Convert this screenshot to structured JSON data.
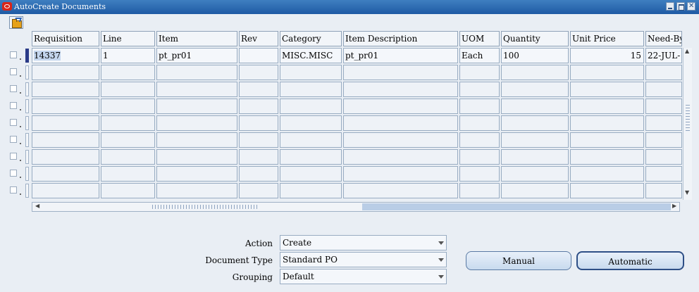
{
  "window": {
    "title": "AutoCreate Documents"
  },
  "table": {
    "columns": [
      "Requisition",
      "Line",
      "Item",
      "Rev",
      "Category",
      "Item Description",
      "UOM",
      "Quantity",
      "Unit Price",
      "Need-By"
    ],
    "rows": [
      [
        "14337",
        "1",
        "pt_pr01",
        "",
        "MISC.MISC",
        "pt_pr01",
        "Each",
        "100",
        "15",
        "22-JUL-"
      ]
    ]
  },
  "form": {
    "action_label": "Action",
    "action_value": "Create",
    "doctype_label": "Document Type",
    "doctype_value": "Standard PO",
    "grouping_label": "Grouping",
    "grouping_value": "Default"
  },
  "buttons": {
    "manual": "Manual",
    "automatic": "Automatic"
  },
  "icons": {
    "app": "oracle-icon",
    "tool": "open-folder-icon"
  }
}
